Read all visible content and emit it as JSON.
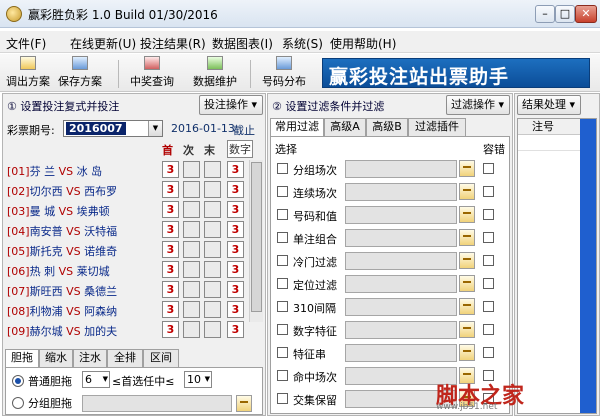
{
  "window": {
    "title": "赢彩胜负彩 1.0 Build 01/30/2016",
    "min": "–",
    "max": "□",
    "close": "✕"
  },
  "menu": [
    "文件(F)",
    "在线更新(U)",
    "投注结果(R)",
    "数据图表(I)",
    "系统(S)",
    "使用帮助(H)"
  ],
  "toolbar": {
    "buttons": [
      "调出方案",
      "保存方案",
      "中奖查询",
      "数据维护",
      "号码分布"
    ],
    "banner": "赢彩投注站出票助手"
  },
  "left": {
    "title": "① 设置投注复式并投注",
    "bet_btn": "投注操作 ▾",
    "issue_label": "彩票期号:",
    "issue_value": "2016007",
    "date": "2016-01-13",
    "deadline": "截止",
    "headers": {
      "win": "首",
      "draw": "次",
      "loss": "末",
      "count": "数字"
    },
    "matches": [
      {
        "idx": "[01]",
        "home": "芬  兰",
        "vs": "VS",
        "away": "冰  岛",
        "val": "3",
        "count": "3"
      },
      {
        "idx": "[02]",
        "home": "切尔西",
        "vs": "VS",
        "away": "西布罗",
        "val": "3",
        "count": "3"
      },
      {
        "idx": "[03]",
        "home": "曼  城",
        "vs": "VS",
        "away": "埃弗顿",
        "val": "3",
        "count": "3"
      },
      {
        "idx": "[04]",
        "home": "南安普",
        "vs": "VS",
        "away": "沃特福",
        "val": "3",
        "count": "3"
      },
      {
        "idx": "[05]",
        "home": "斯托克",
        "vs": "VS",
        "away": "诺维奇",
        "val": "3",
        "count": "3"
      },
      {
        "idx": "[06]",
        "home": "热  刺",
        "vs": "VS",
        "away": "莱切城",
        "val": "3",
        "count": "3"
      },
      {
        "idx": "[07]",
        "home": "斯旺西",
        "vs": "VS",
        "away": "桑德兰",
        "val": "3",
        "count": "3"
      },
      {
        "idx": "[08]",
        "home": "利物浦",
        "vs": "VS",
        "away": "阿森纳",
        "val": "3",
        "count": "3"
      },
      {
        "idx": "[09]",
        "home": "赫尔城",
        "vs": "VS",
        "away": "加的夫",
        "val": "3",
        "count": "3"
      }
    ],
    "tabs": [
      "胆拖",
      "缩水",
      "注水",
      "全排",
      "区间"
    ],
    "option1": {
      "label": "普通胆拖",
      "val": "6",
      "mid": "≤首选任中≤",
      "val2": "10"
    },
    "option2": {
      "label": "分组胆拖"
    }
  },
  "middle": {
    "title": "② 设置过滤条件并过滤",
    "filter_btn": "过滤操作 ▾",
    "tabs": [
      "常用过滤",
      "高级A",
      "高级B",
      "过滤插件"
    ],
    "col_select": "选择",
    "col_fault": "容错",
    "filters": [
      "分组场次",
      "连续场次",
      "号码和值",
      "单注组合",
      "冷门过滤",
      "定位过滤",
      "310间隔",
      "数字特征",
      "特征串",
      "命中场次",
      "交集保留"
    ]
  },
  "right": {
    "result_btn": "结果处理 ▾",
    "col": "注号"
  },
  "watermark": {
    "text": "脚本之家",
    "url": "www.jb51.net"
  }
}
